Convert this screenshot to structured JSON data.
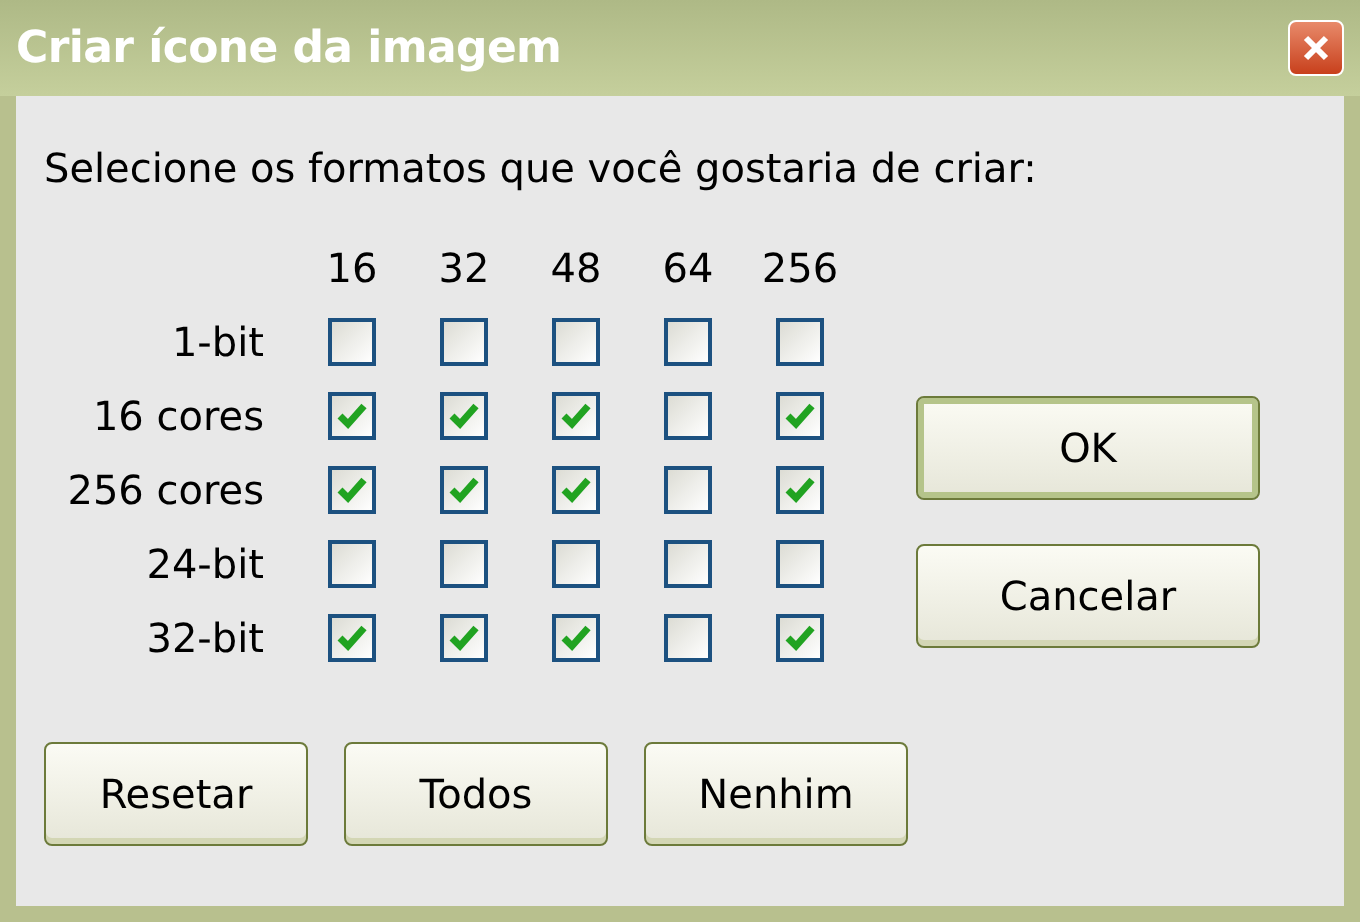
{
  "window": {
    "title": "Criar ícone da imagem"
  },
  "prompt": "Selecione os formatos que você gostaria de criar:",
  "columns": [
    "16",
    "32",
    "48",
    "64",
    "256"
  ],
  "rows": [
    {
      "label": "1-bit",
      "cells": [
        {
          "checked": false
        },
        {
          "checked": false
        },
        {
          "checked": false
        },
        {
          "checked": false
        },
        {
          "checked": false
        }
      ]
    },
    {
      "label": "16 cores",
      "cells": [
        {
          "checked": true
        },
        {
          "checked": true
        },
        {
          "checked": true
        },
        {
          "checked": false
        },
        {
          "checked": true
        }
      ]
    },
    {
      "label": "256 cores",
      "cells": [
        {
          "checked": true
        },
        {
          "checked": true
        },
        {
          "checked": true
        },
        {
          "checked": false
        },
        {
          "checked": true
        }
      ]
    },
    {
      "label": "24-bit",
      "cells": [
        {
          "checked": false
        },
        {
          "checked": false
        },
        {
          "checked": false
        },
        {
          "checked": false
        },
        {
          "checked": false
        }
      ]
    },
    {
      "label": "32-bit",
      "cells": [
        {
          "checked": true
        },
        {
          "checked": true
        },
        {
          "checked": true
        },
        {
          "checked": false
        },
        {
          "checked": true
        }
      ]
    }
  ],
  "bottom_buttons": [
    "Resetar",
    "Todos",
    "Nenhim"
  ],
  "side_buttons": [
    {
      "label": "OK",
      "default": true
    },
    {
      "label": "Cancelar",
      "default": false
    }
  ]
}
